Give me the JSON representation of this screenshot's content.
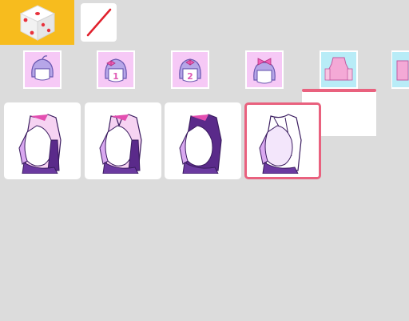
{
  "toolbar": {
    "randomize_icon": "dice-icon",
    "none_icon": "slash-none-icon",
    "accent_color": "#f7bc1e"
  },
  "category_tabs": [
    {
      "icon": "hair-front-icon",
      "label": ""
    },
    {
      "icon": "hair-bow-icon",
      "label": "1"
    },
    {
      "icon": "hair-bow-icon",
      "label": "2"
    },
    {
      "icon": "hair-bow-top-icon",
      "label": ""
    },
    {
      "icon": "top-clothing-icon",
      "label": "",
      "selected": true
    },
    {
      "icon": "partial-tab-icon",
      "label": ""
    }
  ],
  "item_options": [
    {
      "icon": "shirt-option-1-icon"
    },
    {
      "icon": "shirt-option-2-icon"
    },
    {
      "icon": "shirt-option-3-icon"
    },
    {
      "icon": "shirt-option-4-icon",
      "selected": true
    }
  ],
  "colors": {
    "background": "#dcdcdc",
    "selection": "#e9617e",
    "thumb_pink": "#f6c9f6",
    "thumb_cyan": "#b8ecf7",
    "outfit_purple": "#5a2a8a"
  }
}
